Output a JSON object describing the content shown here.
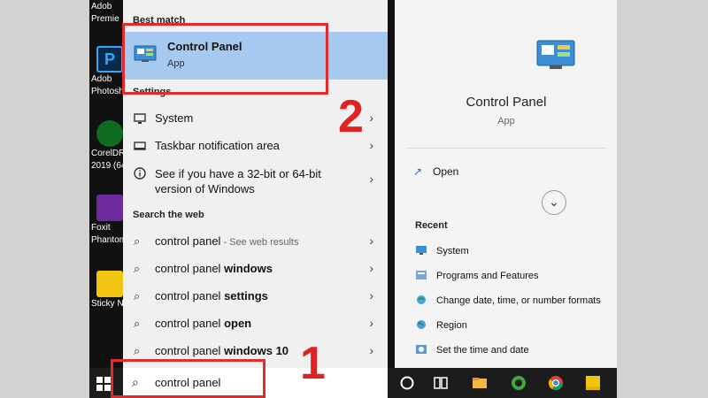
{
  "desktop_icons": [
    {
      "label": "Adob",
      "label2": "Premie",
      "color": "#1b1b5e"
    },
    {
      "label": "Adob",
      "label2": "Photosh",
      "color": "#0b2a4a"
    },
    {
      "label": "CorelDR",
      "label2": "2019 (64",
      "color": "#0e6b1f"
    },
    {
      "label": "Foxit",
      "label2": "Phantom",
      "color": "#6c2a9c"
    },
    {
      "label": "Sticky N",
      "label2": "",
      "color": "#f1c40f"
    }
  ],
  "sections": {
    "best_match": "Best match",
    "settings": "Settings",
    "search_web": "Search the web"
  },
  "best_match": {
    "title": "Control Panel",
    "subtitle": "App"
  },
  "settings_items": [
    {
      "icon": "system-icon",
      "label": "System"
    },
    {
      "icon": "taskbar-icon",
      "label": "Taskbar notification area"
    },
    {
      "icon": "info-icon",
      "label": "See if you have a 32-bit or 64-bit",
      "label2": "version of Windows"
    }
  ],
  "web_items": [
    {
      "prefix": "control panel",
      "bold": "",
      "hint": " - See web results"
    },
    {
      "prefix": "control panel ",
      "bold": "windows",
      "hint": ""
    },
    {
      "prefix": "control panel ",
      "bold": "settings",
      "hint": ""
    },
    {
      "prefix": "control panel ",
      "bold": "open",
      "hint": ""
    },
    {
      "prefix": "control panel ",
      "bold": "windows 10",
      "hint": ""
    }
  ],
  "detail": {
    "title": "Control Panel",
    "subtitle": "App",
    "open_label": "Open",
    "recent_head": "Recent",
    "recent": [
      "System",
      "Programs and Features",
      "Change date, time, or number formats",
      "Region",
      "Set the time and date"
    ]
  },
  "search": {
    "value": "control panel"
  },
  "annotations": {
    "one": "1",
    "two": "2"
  },
  "colors": {
    "highlight": "#a5c9ef",
    "annotation": "#e22b2b",
    "taskbar": "#1c1c1c"
  }
}
